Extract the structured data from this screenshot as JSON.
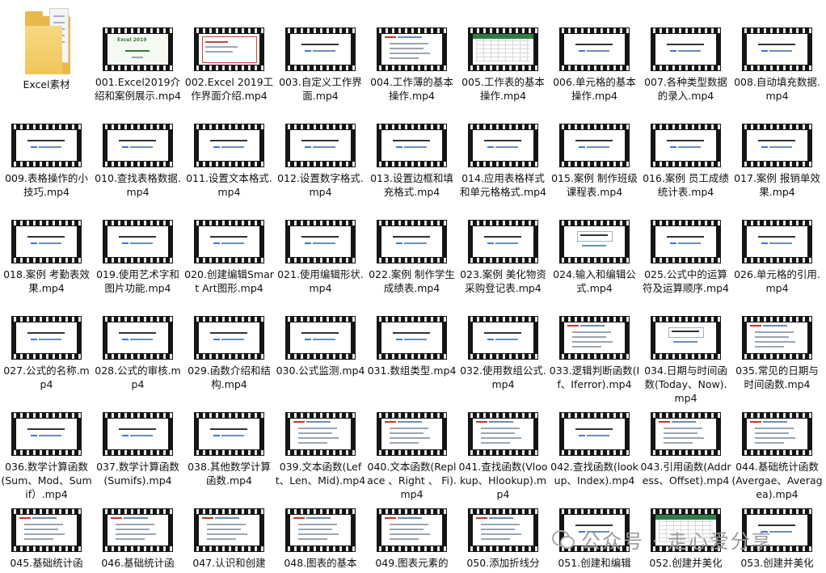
{
  "watermark": "公众号 · 走心爱分享",
  "files": [
    {
      "name": "Excel素材",
      "type": "folder"
    },
    {
      "name": "001.Excel2019介绍和案例展示.mp4",
      "style": "excel2019"
    },
    {
      "name": "002.Excel 2019工作界面介绍.mp4",
      "style": "ui"
    },
    {
      "name": "003.自定义工作界面.mp4",
      "style": "title"
    },
    {
      "name": "004.工作薄的基本操作.mp4",
      "style": "list"
    },
    {
      "name": "005.工作表的基本操作.mp4",
      "style": "ribbon"
    },
    {
      "name": "006.单元格的基本操作.mp4",
      "style": "title"
    },
    {
      "name": "007.各种类型数据的录入.mp4",
      "style": "title"
    },
    {
      "name": "008.自动填充数据.mp4",
      "style": "title"
    },
    {
      "name": "009.表格操作的小技巧.mp4",
      "style": "title"
    },
    {
      "name": "010.查找表格数据.mp4",
      "style": "title"
    },
    {
      "name": "011.设置文本格式.mp4",
      "style": "title"
    },
    {
      "name": "012.设置数字格式.mp4",
      "style": "title"
    },
    {
      "name": "013.设置边框和填充格式.mp4",
      "style": "title"
    },
    {
      "name": "014.应用表格样式和单元格格式.mp4",
      "style": "title"
    },
    {
      "name": "015.案例 制作班级课程表.mp4",
      "style": "title"
    },
    {
      "name": "016.案例 员工成绩统计表.mp4",
      "style": "title"
    },
    {
      "name": "017.案例 报销单效果.mp4",
      "style": "title"
    },
    {
      "name": "018.案例 考勤表效果.mp4",
      "style": "title"
    },
    {
      "name": "019.使用艺术字和图片功能.mp4",
      "style": "title"
    },
    {
      "name": "020.创建编辑Smart Art图形.mp4",
      "style": "title"
    },
    {
      "name": "021.使用编辑形状.mp4",
      "style": "title"
    },
    {
      "name": "022.案例 制作学生成绩表.mp4",
      "style": "title"
    },
    {
      "name": "023.案例 美化物资采购登记表.mp4",
      "style": "title"
    },
    {
      "name": "024.输入和编辑公式.mp4",
      "style": "framed"
    },
    {
      "name": "025.公式中的运算符及运算顺序.mp4",
      "style": "title"
    },
    {
      "name": "026.单元格的引用.mp4",
      "style": "title"
    },
    {
      "name": "027.公式的名称.mp4",
      "style": "title"
    },
    {
      "name": "028.公式的审核.mp4",
      "style": "title"
    },
    {
      "name": "029.函数介绍和结构.mp4",
      "style": "title"
    },
    {
      "name": "030.公式监测.mp4",
      "style": "title"
    },
    {
      "name": "031.数组类型.mp4",
      "style": "title"
    },
    {
      "name": "032.使用数组公式.mp4",
      "style": "title"
    },
    {
      "name": "033.逻辑判断函数(If、Iferror).mp4",
      "style": "list"
    },
    {
      "name": "034.日期与时间函数(Today、Now).mp4",
      "style": "framed"
    },
    {
      "name": "035.常见的日期与时间函数.mp4",
      "style": "list"
    },
    {
      "name": "036.数学计算函数(Sum、Mod、Sumif）.mp4",
      "style": "title"
    },
    {
      "name": "037.数学计算函数(Sumifs).mp4",
      "style": "title"
    },
    {
      "name": "038.其他数学计算函数.mp4",
      "style": "title"
    },
    {
      "name": "039.文本函数(Left、Len、Mid).mp4",
      "style": "list"
    },
    {
      "name": "040.文本函数(Replace 、Right 、 Fi).mp4",
      "style": "list"
    },
    {
      "name": "041.查找函数(Vlookup、Hlookup).mp4",
      "style": "list"
    },
    {
      "name": "042.查找函数(lookup、Index).mp4",
      "style": "title"
    },
    {
      "name": "043.引用函数(Address、Offset).mp4",
      "style": "list"
    },
    {
      "name": "044.基础统计函数(Avergae、Averagea).mp4",
      "style": "list"
    },
    {
      "name": "045.基础统计函",
      "style": "list"
    },
    {
      "name": "046.基础统计函",
      "style": "list"
    },
    {
      "name": "047.认识和创建",
      "style": "list"
    },
    {
      "name": "048.图表的基本",
      "style": "list"
    },
    {
      "name": "049.图表元素的",
      "style": "list"
    },
    {
      "name": "050.添加折线分",
      "style": "list"
    },
    {
      "name": "051.创建和编辑",
      "style": "title"
    },
    {
      "name": "052.创建并美化",
      "style": "ribbon"
    },
    {
      "name": "053.创建并美化",
      "style": "title"
    }
  ]
}
